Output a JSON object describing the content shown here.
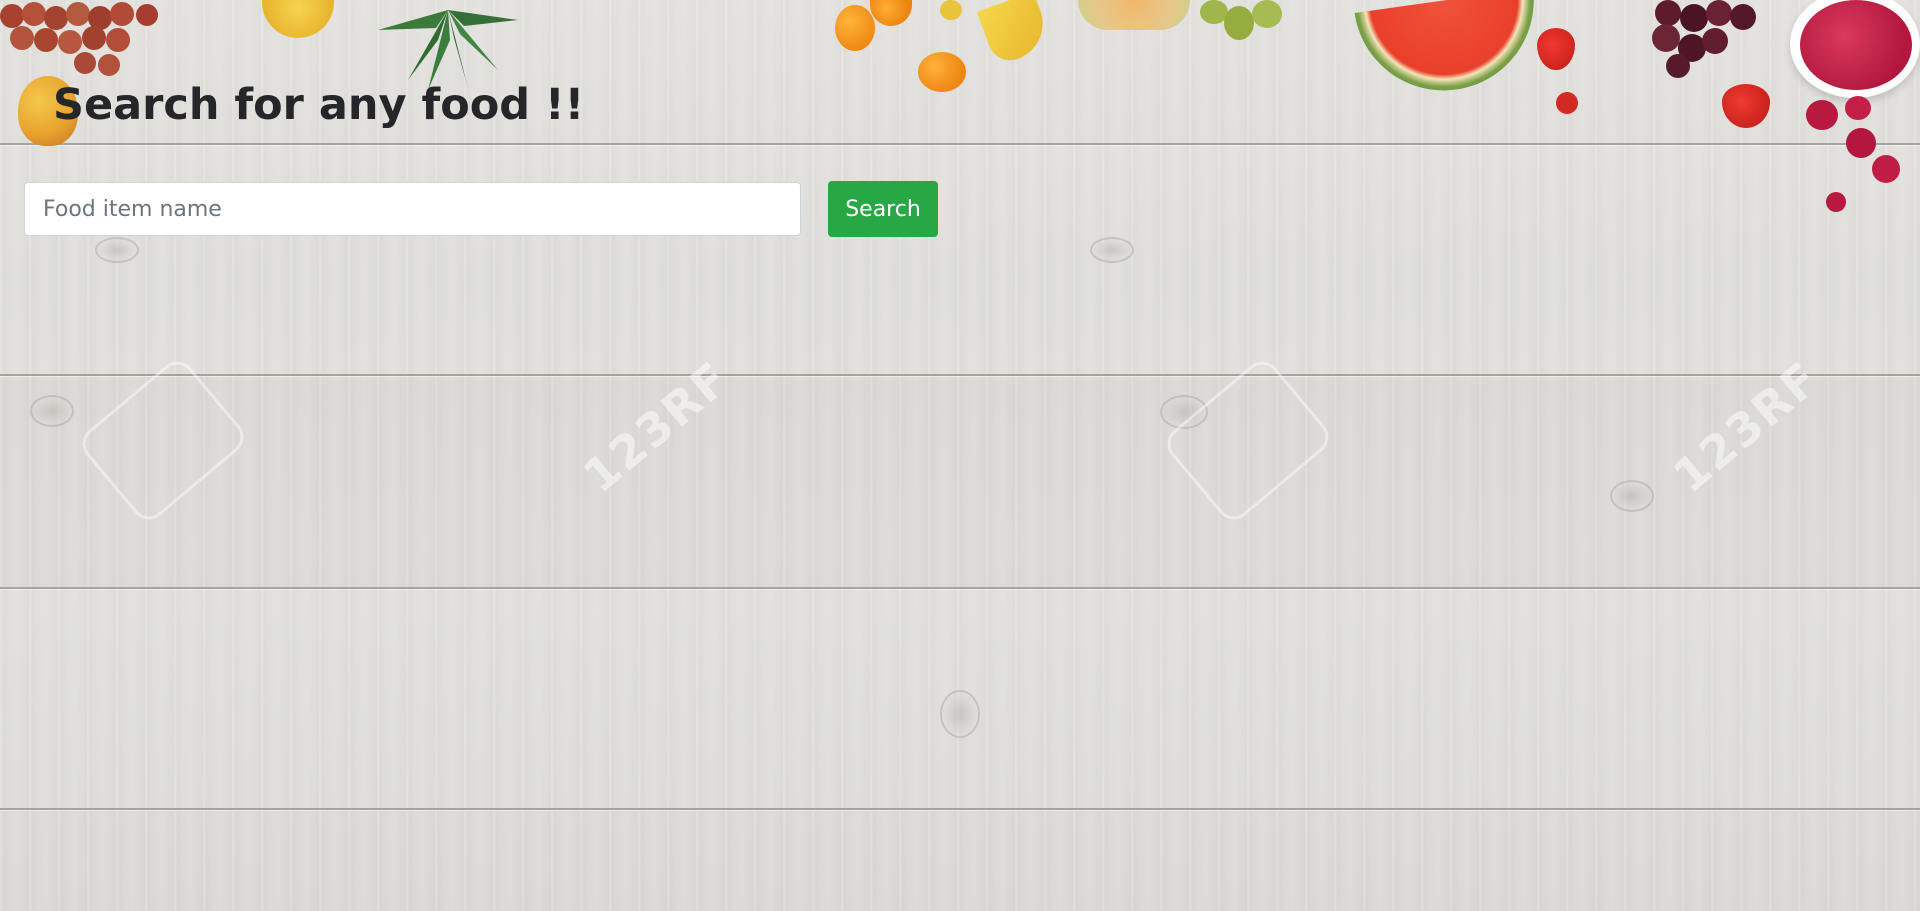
{
  "page": {
    "title": "Search for any food !!"
  },
  "search": {
    "placeholder": "Food item name",
    "value": "",
    "button_label": "Search"
  },
  "background": {
    "watermark_text": "123RF"
  },
  "colors": {
    "title": "#25262a",
    "button": "#28a745",
    "button_text": "#ffffff",
    "wood": "#dcdbd7"
  }
}
